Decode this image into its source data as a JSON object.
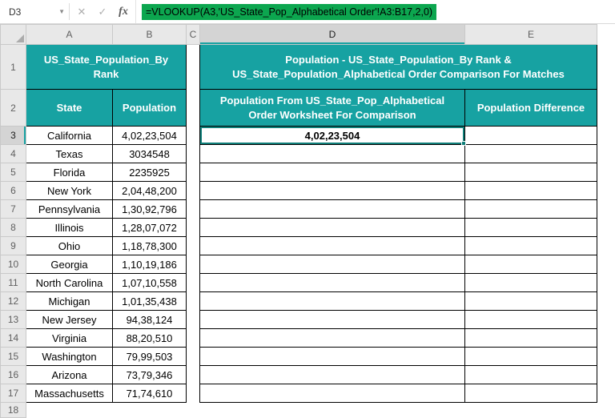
{
  "formula_bar": {
    "cell_reference": "D3",
    "chevron_label": "▼",
    "cancel_label": "✕",
    "enter_label": "✓",
    "fx_label": "fx",
    "formula": "=VLOOKUP(A3,'US_State_Pop_Alphabetical Order'!A3:B17,2,0)"
  },
  "sheet": {
    "columns": [
      "A",
      "B",
      "C",
      "D",
      "E"
    ],
    "row1_number": "1",
    "row2_number": "2",
    "trailing_row_number": "18",
    "selection": {
      "cell": "D3",
      "column": "D",
      "row": "3"
    },
    "left_table": {
      "title_lines": [
        "US_State_Population_By",
        "Rank"
      ],
      "headers": [
        "State",
        "Population"
      ]
    },
    "right_table": {
      "title_lines": [
        "Population - US_State_Population_By Rank &",
        "US_State_Population_Alphabetical Order Comparison For Matches"
      ],
      "d_header_lines": [
        "Population From US_State_Pop_Alphabetical",
        "Order Worksheet For Comparison"
      ],
      "e_header": "Population Difference"
    },
    "rows": [
      {
        "n": "3",
        "state": "California",
        "pop": "4,02,23,504",
        "d": "4,02,23,504",
        "e": "",
        "selected": true
      },
      {
        "n": "4",
        "state": "Texas",
        "pop": "3034548",
        "d": "",
        "e": ""
      },
      {
        "n": "5",
        "state": "Florida",
        "pop": "2235925",
        "d": "",
        "e": ""
      },
      {
        "n": "6",
        "state": "New York",
        "pop": "2,04,48,200",
        "d": "",
        "e": ""
      },
      {
        "n": "7",
        "state": "Pennsylvania",
        "pop": "1,30,92,796",
        "d": "",
        "e": ""
      },
      {
        "n": "8",
        "state": "Illinois",
        "pop": "1,28,07,072",
        "d": "",
        "e": ""
      },
      {
        "n": "9",
        "state": "Ohio",
        "pop": "1,18,78,300",
        "d": "",
        "e": ""
      },
      {
        "n": "10",
        "state": "Georgia",
        "pop": "1,10,19,186",
        "d": "",
        "e": ""
      },
      {
        "n": "11",
        "state": "North Carolina",
        "pop": "1,07,10,558",
        "d": "",
        "e": ""
      },
      {
        "n": "12",
        "state": "Michigan",
        "pop": "1,01,35,438",
        "d": "",
        "e": ""
      },
      {
        "n": "13",
        "state": "New Jersey",
        "pop": "94,38,124",
        "d": "",
        "e": ""
      },
      {
        "n": "14",
        "state": "Virginia",
        "pop": "88,20,510",
        "d": "",
        "e": ""
      },
      {
        "n": "15",
        "state": "Washington",
        "pop": "79,99,503",
        "d": "",
        "e": ""
      },
      {
        "n": "16",
        "state": "Arizona",
        "pop": "73,79,346",
        "d": "",
        "e": ""
      },
      {
        "n": "17",
        "state": "Massachusetts",
        "pop": "71,74,610",
        "d": "",
        "e": ""
      }
    ]
  },
  "colors": {
    "header_fill": "#17A2A2",
    "selection_border": "#0F7E78",
    "formula_highlight": "#0CA64F"
  }
}
